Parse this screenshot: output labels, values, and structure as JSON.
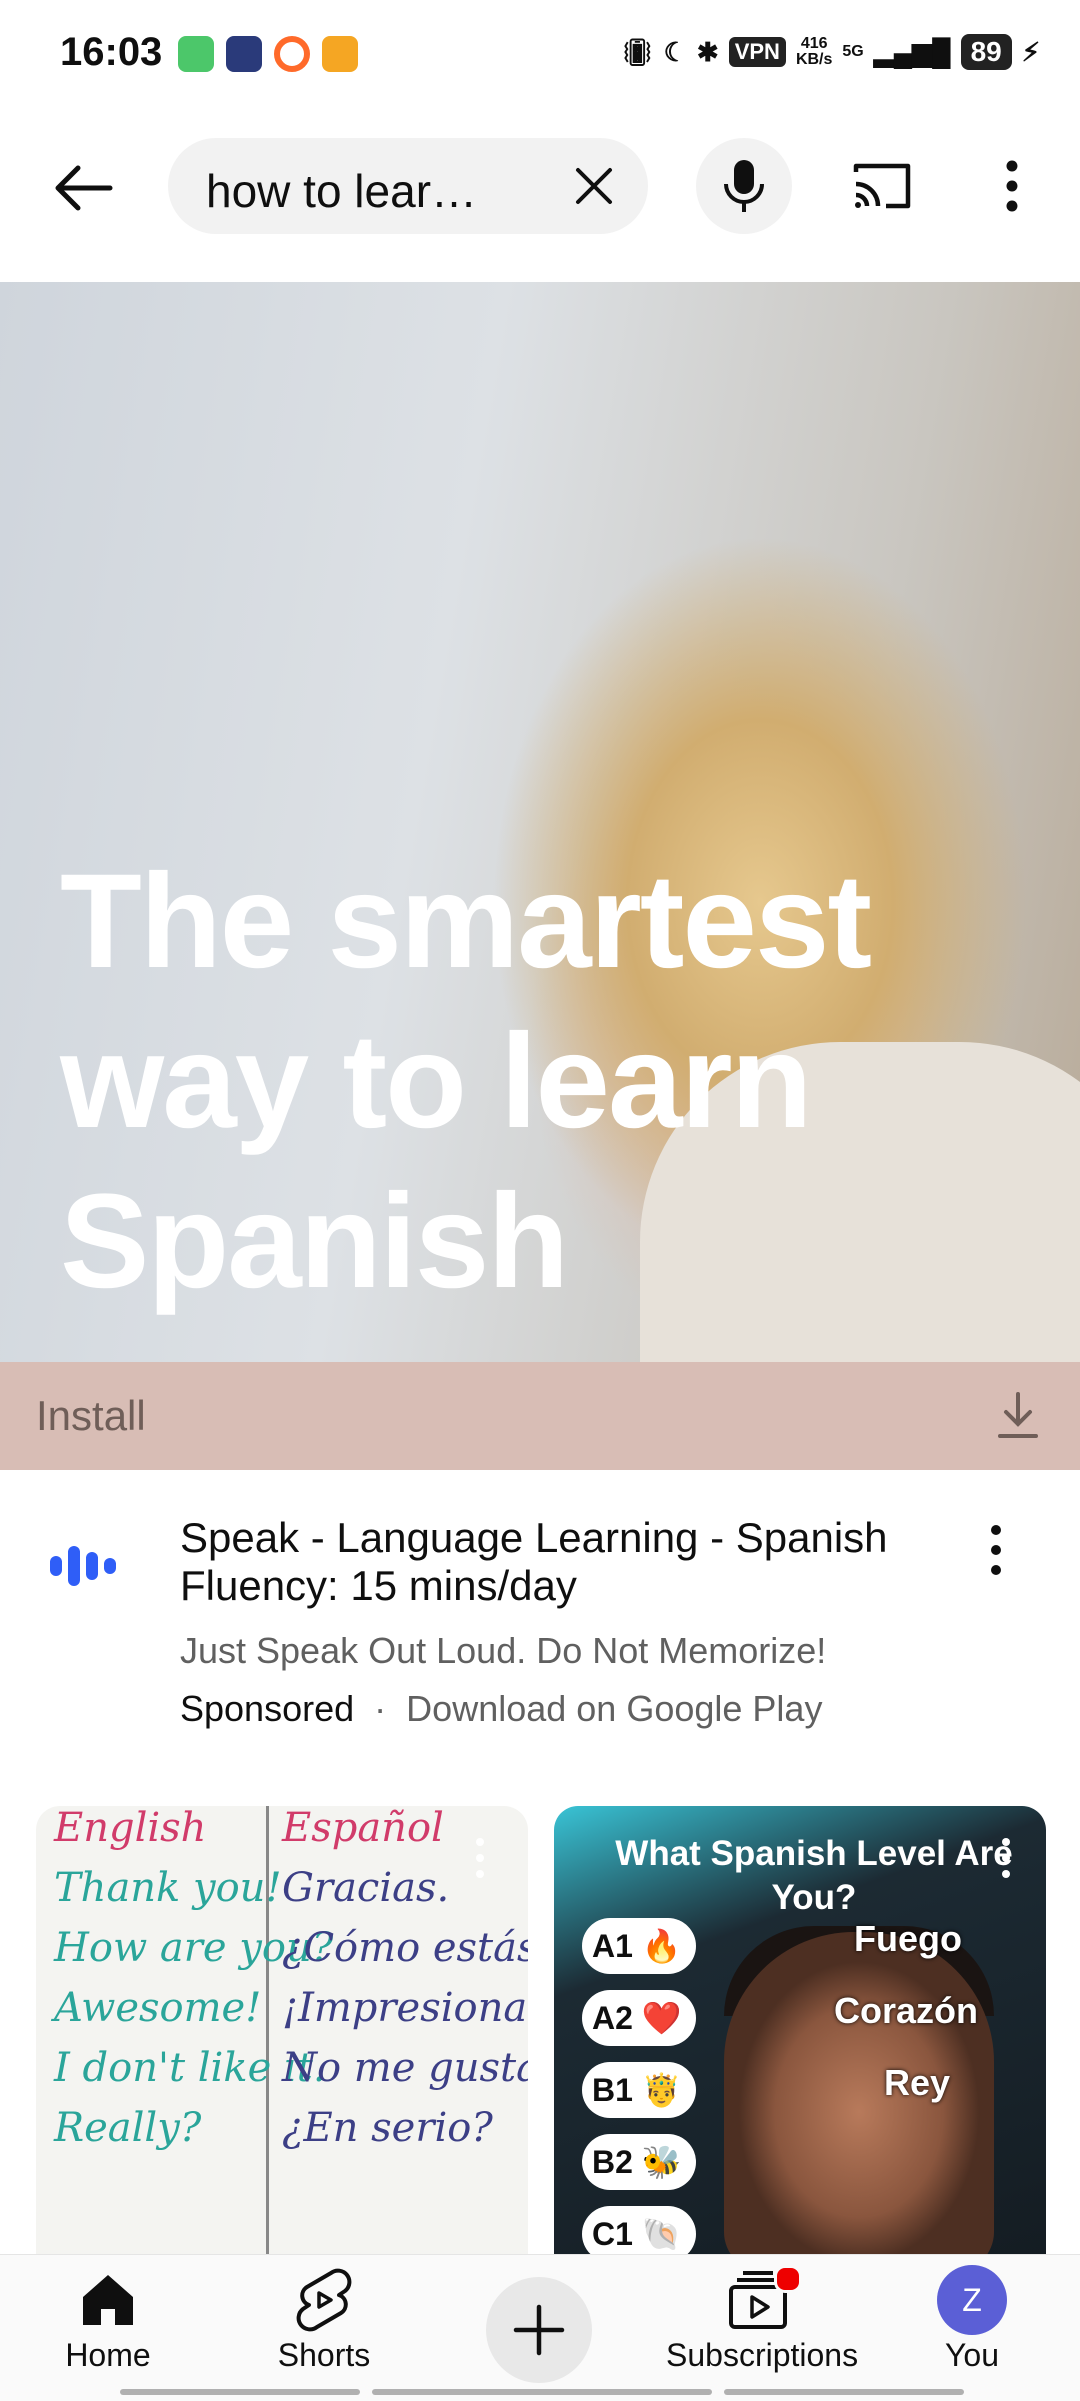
{
  "status_bar": {
    "time": "16:03",
    "vpn": "VPN",
    "speed_value": "416",
    "speed_unit": "KB/s",
    "network": "5G",
    "battery": "89"
  },
  "search": {
    "query": "how to lear…"
  },
  "ad": {
    "headline": "The smartest way to learn Spanish",
    "install_label": "Install",
    "title": "Speak - Language Learning - Spanish Fluency: 15 mins/day",
    "subtitle": "Just Speak Out Loud. Do Not Memorize!",
    "sponsored": "Sponsored",
    "separator": "·",
    "cta_text": "Download on Google Play",
    "brand_color": "#2f5ef7"
  },
  "shorts": [
    {
      "header_left": "English",
      "header_right": "Español",
      "left_lines": [
        "Thank you!",
        "How are you?",
        "Awesome!",
        "I don't like it.",
        "Really?"
      ],
      "right_lines": [
        "Gracias.",
        "¿Cómo estás?",
        "¡Impresionante!",
        "No me gusta.",
        "¿En serio?"
      ]
    },
    {
      "title": "What Spanish Level Are You?",
      "levels": [
        {
          "code": "A1",
          "emoji": "🔥",
          "label": "Fuego"
        },
        {
          "code": "A2",
          "emoji": "❤️",
          "label": "Corazón"
        },
        {
          "code": "B1",
          "emoji": "🤴",
          "label": "Rey"
        },
        {
          "code": "B2",
          "emoji": "🐝",
          "label": ""
        },
        {
          "code": "C1",
          "emoji": "🐚",
          "label": ""
        }
      ]
    }
  ],
  "nav": {
    "home": "Home",
    "shorts": "Shorts",
    "subscriptions": "Subscriptions",
    "you": "You",
    "avatar_letter": "Z"
  }
}
